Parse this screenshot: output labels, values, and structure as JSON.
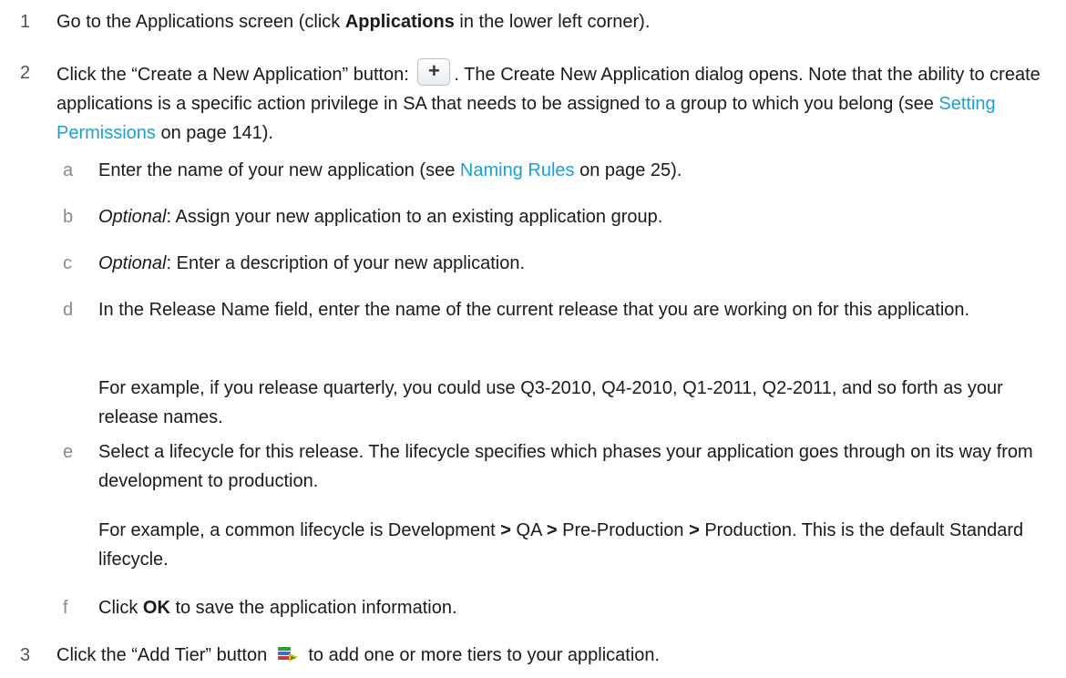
{
  "steps": [
    {
      "num": "1",
      "t1": "Go to the Applications screen (click ",
      "b1": "Applications",
      "t2": " in the lower left corner)."
    },
    {
      "num": "2",
      "t1": "Click the “Create a New Application” button: ",
      "t2": ". The Create New Application dialog opens. Note that the ability to create applications is a specific action privilege in SA that needs to be assigned to a group to which you belong (see ",
      "link": "Setting Permissions",
      "t3": " on page 141)."
    },
    {
      "num": "3",
      "t1": "Click the “Add Tier” button ",
      "t2": " to add one or more tiers to your application."
    }
  ],
  "substeps": [
    {
      "num": "a",
      "t1": "Enter the name of your new application (see ",
      "link": "Naming Rules",
      "t2": " on page 25)."
    },
    {
      "num": "b",
      "em": "Optional",
      "t1": ": Assign your new application to an existing application group."
    },
    {
      "num": "c",
      "em": "Optional",
      "t1": ": Enter a description of your new application."
    },
    {
      "num": "d",
      "t1": "In the Release Name field, enter the name of the current release that you are working on for this application."
    },
    {
      "num": "d_note",
      "t1": "For example, if you release quarterly, you could use Q3-2010, Q4-2010, Q1-2011, Q2-2011, and so forth as your release names."
    },
    {
      "num": "e",
      "t1": "Select a lifecycle for this release. The lifecycle specifies which phases your application goes through on its way from development to production."
    },
    {
      "num": "e_note",
      "t1": "For example, a common lifecycle is Development  ",
      "g1": ">",
      "t2": "  QA  ",
      "g2": ">",
      "t3": "  Pre-Production  ",
      "g3": ">",
      "t4": "  Production. This is the default Standard lifecycle."
    },
    {
      "num": "f",
      "t1": "Click ",
      "b1": "OK",
      "t2": " to save the application information."
    }
  ],
  "icons": {
    "plus": "plus-icon",
    "tier": "add-tier-icon",
    "plus_glyph": "+"
  }
}
